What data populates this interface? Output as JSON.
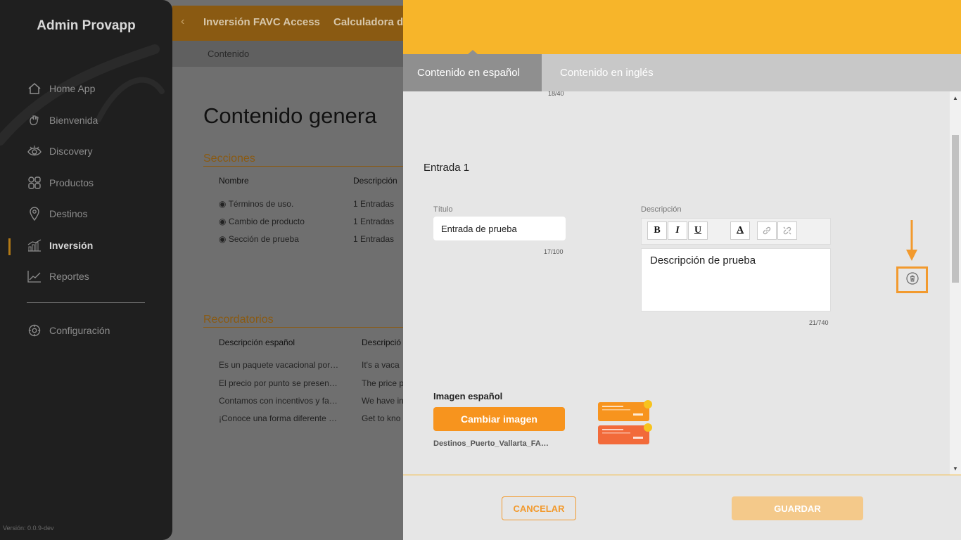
{
  "sidebar": {
    "brand": "Admin Provapp",
    "items": [
      {
        "label": "Home App",
        "icon": "home-icon"
      },
      {
        "label": "Bienvenida",
        "icon": "wave-hand-icon"
      },
      {
        "label": "Discovery",
        "icon": "eye-icon"
      },
      {
        "label": "Productos",
        "icon": "grid-icon"
      },
      {
        "label": "Destinos",
        "icon": "map-pin-icon"
      },
      {
        "label": "Inversión",
        "icon": "bar-chart-icon",
        "active": true
      },
      {
        "label": "Reportes",
        "icon": "line-chart-icon"
      },
      {
        "label": "Configuración",
        "icon": "gear-icon"
      }
    ],
    "version": "Versión: 0.0.9-dev"
  },
  "background": {
    "header_title": "Inversión FAVC Access",
    "header_tab2": "Calculadora d",
    "breadcrumb": "Contenido",
    "page_title": "Contenido genera",
    "sections_title": "Secciones",
    "sections_cols": [
      "Nombre",
      "Descripción"
    ],
    "sections_rows": [
      [
        "Términos de uso.",
        "1 Entradas"
      ],
      [
        "Cambio de producto",
        "1 Entradas"
      ],
      [
        "Sección de prueba",
        "1 Entradas"
      ]
    ],
    "reminders_title": "Recordatorios",
    "reminders_cols": [
      "Descripción español",
      "Descripció"
    ],
    "reminders_rows": [
      [
        "Es un paquete vacacional por…",
        "It's a vaca"
      ],
      [
        "El precio por punto se presen…",
        "The price p"
      ],
      [
        "Contamos con incentivos y fa…",
        "We have in"
      ],
      [
        "¡Conoce una forma diferente …",
        "Get to kno"
      ]
    ]
  },
  "modal": {
    "tabs": [
      "Contenido en español",
      "Contenido en inglés"
    ],
    "counter_top": "18/40",
    "entry_title": "Entrada 1",
    "title_label": "Título",
    "title_value": "Entrada de prueba",
    "title_counter": "17/100",
    "desc_label": "Descripción",
    "toolbar": {
      "bold": "B",
      "italic": "I",
      "underline": "U",
      "color": "A"
    },
    "desc_value": "Descripción de prueba",
    "desc_counter": "21/740",
    "image_label": "Imagen español",
    "change_image": "Cambiar imagen",
    "filename": "Destinos_Puerto_Vallarta_FA…",
    "cancel": "CANCELAR",
    "save": "GUARDAR"
  },
  "colors": {
    "accent": "#f7b52a",
    "orange_button": "#f7941e",
    "highlight": "#f29a2e",
    "sidebar_bg": "#1f1f1f"
  }
}
